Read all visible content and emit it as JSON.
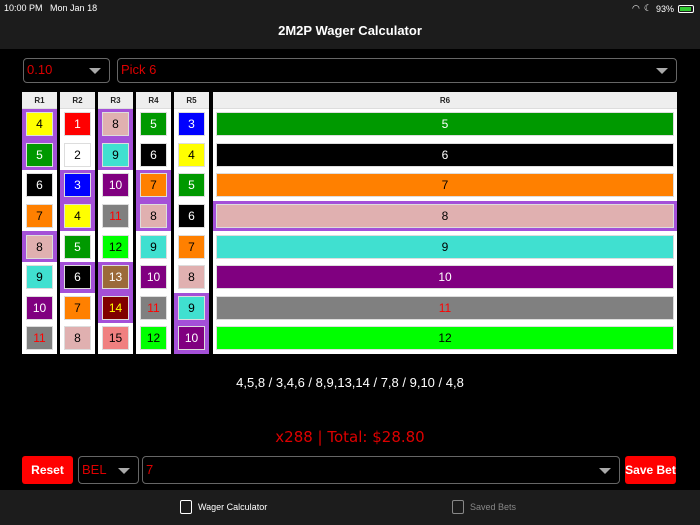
{
  "status": {
    "time": "10:00 PM",
    "date": "Mon Jan 18",
    "battery": "93%"
  },
  "title": "2M2P Wager Calculator",
  "amount_select": "0.10",
  "bet_type_select": "Pick 6",
  "colors": {
    "1": [
      "#ff0000",
      "#ffffff"
    ],
    "2": [
      "#ffffff",
      "#000000"
    ],
    "3": [
      "#0000ff",
      "#ffffff"
    ],
    "4": [
      "#ffff00",
      "#000000"
    ],
    "5": [
      "#009900",
      "#ffffff"
    ],
    "6": [
      "#000000",
      "#ffffff"
    ],
    "7": [
      "#ff8000",
      "#000000"
    ],
    "8": [
      "#e0b0b0",
      "#000000"
    ],
    "9": [
      "#40e0d0",
      "#000000"
    ],
    "10": [
      "#800080",
      "#ffffff"
    ],
    "11": [
      "#808080",
      "#ff0000"
    ],
    "12": [
      "#00ff00",
      "#000000"
    ],
    "13": [
      "#9b6a3a",
      "#ffffff"
    ],
    "14": [
      "#800000",
      "#ffff00"
    ],
    "15": [
      "#f08080",
      "#000000"
    ]
  },
  "races": [
    {
      "label": "R1",
      "runners": [
        {
          "n": "4",
          "sel": true
        },
        {
          "n": "5",
          "sel": true
        },
        {
          "n": "6",
          "sel": false
        },
        {
          "n": "7",
          "sel": false
        },
        {
          "n": "8",
          "sel": true
        },
        {
          "n": "9",
          "sel": false
        },
        {
          "n": "10",
          "sel": false
        },
        {
          "n": "11",
          "sel": false
        }
      ]
    },
    {
      "label": "R2",
      "runners": [
        {
          "n": "1",
          "sel": false
        },
        {
          "n": "2",
          "sel": false
        },
        {
          "n": "3",
          "sel": true
        },
        {
          "n": "4",
          "sel": true
        },
        {
          "n": "5",
          "sel": false
        },
        {
          "n": "6",
          "sel": true
        },
        {
          "n": "7",
          "sel": false
        },
        {
          "n": "8",
          "sel": false
        }
      ]
    },
    {
      "label": "R3",
      "runners": [
        {
          "n": "8",
          "sel": true
        },
        {
          "n": "9",
          "sel": true
        },
        {
          "n": "10",
          "sel": false
        },
        {
          "n": "11",
          "sel": false
        },
        {
          "n": "12",
          "sel": false
        },
        {
          "n": "13",
          "sel": true
        },
        {
          "n": "14",
          "sel": true
        },
        {
          "n": "15",
          "sel": false
        }
      ]
    },
    {
      "label": "R4",
      "runners": [
        {
          "n": "5",
          "sel": false
        },
        {
          "n": "6",
          "sel": false
        },
        {
          "n": "7",
          "sel": true
        },
        {
          "n": "8",
          "sel": true
        },
        {
          "n": "9",
          "sel": false
        },
        {
          "n": "10",
          "sel": false
        },
        {
          "n": "11",
          "sel": false
        },
        {
          "n": "12",
          "sel": false
        }
      ]
    },
    {
      "label": "R5",
      "runners": [
        {
          "n": "3",
          "sel": false
        },
        {
          "n": "4",
          "sel": false
        },
        {
          "n": "5",
          "sel": false
        },
        {
          "n": "6",
          "sel": false
        },
        {
          "n": "7",
          "sel": false
        },
        {
          "n": "8",
          "sel": false
        },
        {
          "n": "9",
          "sel": true
        },
        {
          "n": "10",
          "sel": true
        }
      ]
    },
    {
      "label": "R6",
      "runners": [
        {
          "n": "5",
          "sel": false
        },
        {
          "n": "6",
          "sel": false
        },
        {
          "n": "7",
          "sel": false
        },
        {
          "n": "8",
          "sel": true
        },
        {
          "n": "9",
          "sel": false
        },
        {
          "n": "10",
          "sel": false
        },
        {
          "n": "11",
          "sel": false
        },
        {
          "n": "12",
          "sel": false
        }
      ]
    }
  ],
  "summary": "4,5,8 / 3,4,6 / 8,9,13,14 / 7,8 / 9,10 / 4,8",
  "total": "x288 | Total: $28.80",
  "reset_label": "Reset",
  "track_select": "BEL",
  "race_select": "7",
  "save_label": "Save Bet",
  "tabs": [
    {
      "label": "Wager Calculator"
    },
    {
      "label": "Saved Bets"
    }
  ]
}
